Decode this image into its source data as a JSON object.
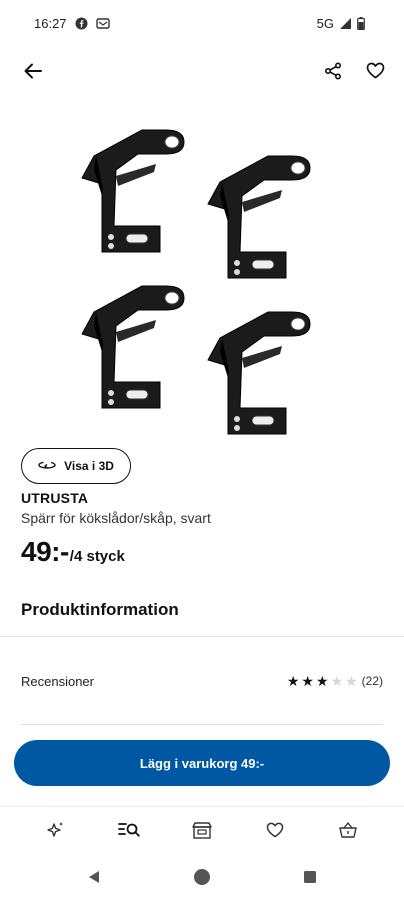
{
  "status_bar": {
    "time": "16:27",
    "network": "5G",
    "icons": [
      "facebook-icon",
      "notification-icon",
      "signal-icon",
      "battery-icon"
    ]
  },
  "top_bar": {
    "icons": [
      "back-arrow-icon",
      "share-icon",
      "heart-icon"
    ]
  },
  "product": {
    "image_icon": "cabinet-bracket-image",
    "view_3d_label": "Visa i 3D",
    "name": "UTRUSTA",
    "description": "Spärr för kökslådor/skåp, svart",
    "price": "49:-",
    "price_unit": "/4 styck"
  },
  "sections": {
    "product_info_title": "Produktinformation"
  },
  "reviews": {
    "label": "Recensioner",
    "rating": 3,
    "max_rating": 5,
    "count": "(22)"
  },
  "cta": {
    "label": "Lägg i varukorg 49:-",
    "color": "#0058a3"
  },
  "bottom_nav": {
    "items": [
      "sparkle-icon",
      "search-list-icon",
      "store-icon",
      "heart-icon",
      "basket-icon"
    ]
  },
  "system_nav": {
    "items": [
      "back-triangle-icon",
      "home-circle-icon",
      "recents-square-icon"
    ]
  }
}
